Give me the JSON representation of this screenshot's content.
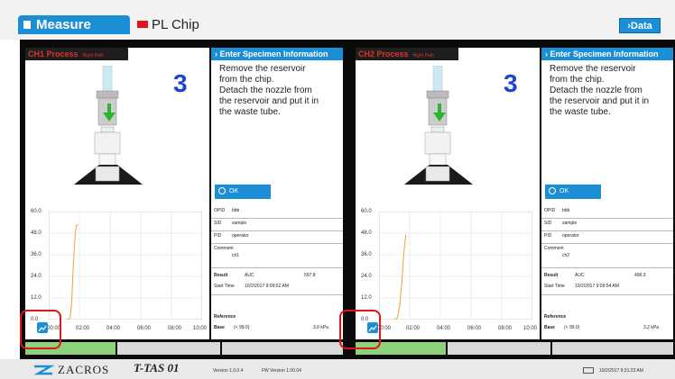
{
  "header": {
    "tabs": [
      {
        "label": "Measure"
      },
      {
        "label": "PL Chip"
      }
    ],
    "data_button": "Data"
  },
  "channels": [
    {
      "process_title": "CH1 Process",
      "process_sub": "Right Path",
      "step": "3",
      "info_title": "Enter Specimen Information",
      "instructions": [
        "Remove the reservoir",
        "from the chip.",
        "Detach the nozzle from",
        "the reservoir and put it in",
        "the waste tube."
      ],
      "ok_label": "OK",
      "y_ticks": [
        "60.0",
        "48.0",
        "36.0",
        "24.0",
        "12.0",
        "0.0"
      ],
      "x_ticks": [
        "00:00",
        "02:00",
        "04:00",
        "06:00",
        "08:00",
        "10:00"
      ],
      "opid_label": "OPID",
      "opid": "bbb",
      "sid_label": "SID",
      "sid": "sample",
      "pid_label": "PID",
      "pid": "operator",
      "comment_label": "Comment",
      "comment": "ch1",
      "result_label": "Result",
      "result_metric": "AUC",
      "result_value": "597.8",
      "start_label": "Start Time",
      "start_time": "10/2/2017 9:09:52 AM",
      "reference_label": "Reference",
      "base_label": "Base",
      "base_range": "(< 99.0)",
      "base_value": "3.6 kPa",
      "curve": [
        [
          1.2,
          0
        ],
        [
          1.4,
          1
        ],
        [
          1.5,
          10
        ],
        [
          1.6,
          30
        ],
        [
          1.7,
          44
        ],
        [
          1.75,
          49
        ],
        [
          1.8,
          52
        ],
        [
          1.9,
          53
        ]
      ]
    },
    {
      "process_title": "CH2 Process",
      "process_sub": "Right Path",
      "step": "3",
      "info_title": "Enter Specimen Information",
      "instructions": [
        "Remove the reservoir",
        "from the chip.",
        "Detach the nozzle from",
        "the reservoir and put it in",
        "the waste tube."
      ],
      "ok_label": "OK",
      "y_ticks": [
        "60.0",
        "48.0",
        "36.0",
        "24.0",
        "12.0",
        "0.0"
      ],
      "x_ticks": [
        "00:00",
        "02:00",
        "04:00",
        "06:00",
        "08:00",
        "10:00"
      ],
      "opid_label": "OPID",
      "opid": "bbb",
      "sid_label": "SID",
      "sid": "sample",
      "pid_label": "PID",
      "pid": "operator",
      "comment_label": "Comment",
      "comment": "ch2",
      "result_label": "Result",
      "result_metric": "AUC",
      "result_value": "496.3",
      "start_label": "Start Time",
      "start_time": "10/2/2017 9:09:54 AM",
      "reference_label": "Reference",
      "base_label": "Base",
      "base_range": "(< 99.0)",
      "base_value": "3.2 kPa",
      "curve": [
        [
          1.0,
          0
        ],
        [
          1.2,
          1
        ],
        [
          1.35,
          8
        ],
        [
          1.5,
          22
        ],
        [
          1.6,
          35
        ],
        [
          1.7,
          44
        ],
        [
          1.75,
          47
        ]
      ]
    }
  ],
  "footer": {
    "brand": "ZACROS",
    "product": "T-TAS 01",
    "system_version": "Version 1.0.0.4",
    "fw_version": "FW Version 1.00.04",
    "clock": "10/2/2017 9:31:23 AM"
  },
  "colors": {
    "accent": "#1b8fd6",
    "alert": "#e0141b",
    "curve": "#f0a040"
  },
  "icons": [
    "zoom-icon",
    "keyboard-icon",
    "zacros-logo"
  ]
}
